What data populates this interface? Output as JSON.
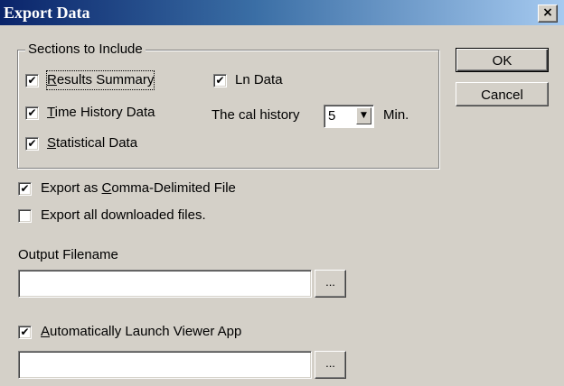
{
  "window": {
    "title": "Export Data",
    "close_glyph": "×"
  },
  "sections": {
    "legend": "Sections to Include",
    "results_summary": {
      "label_ul": "R",
      "label_rest": "esults Summary",
      "checked": true
    },
    "time_history": {
      "label_ul": "T",
      "label_rest": "ime History Data",
      "checked": true
    },
    "statistical": {
      "label_ul": "S",
      "label_rest": "tatistical Data",
      "checked": true
    },
    "ln_data": {
      "label": "Ln Data",
      "checked": true
    },
    "cal_history": {
      "label": "The cal history",
      "value": "5",
      "unit": "Min."
    }
  },
  "buttons": {
    "ok": "OK",
    "cancel": "Cancel"
  },
  "options": {
    "comma_delimited": {
      "label_pre": "Export as ",
      "label_ul": "C",
      "label_rest": "omma-Delimited File",
      "checked": true
    },
    "export_all": {
      "label": "Export all downloaded files.",
      "checked": false
    }
  },
  "output": {
    "label": "Output Filename",
    "value": "",
    "browse": "..."
  },
  "viewer": {
    "checkbox": {
      "label_ul": "A",
      "label_rest": "utomatically Launch Viewer App",
      "checked": true
    },
    "value": "",
    "browse": "..."
  },
  "check_glyph": "✔",
  "dropdown_glyph": "▼"
}
